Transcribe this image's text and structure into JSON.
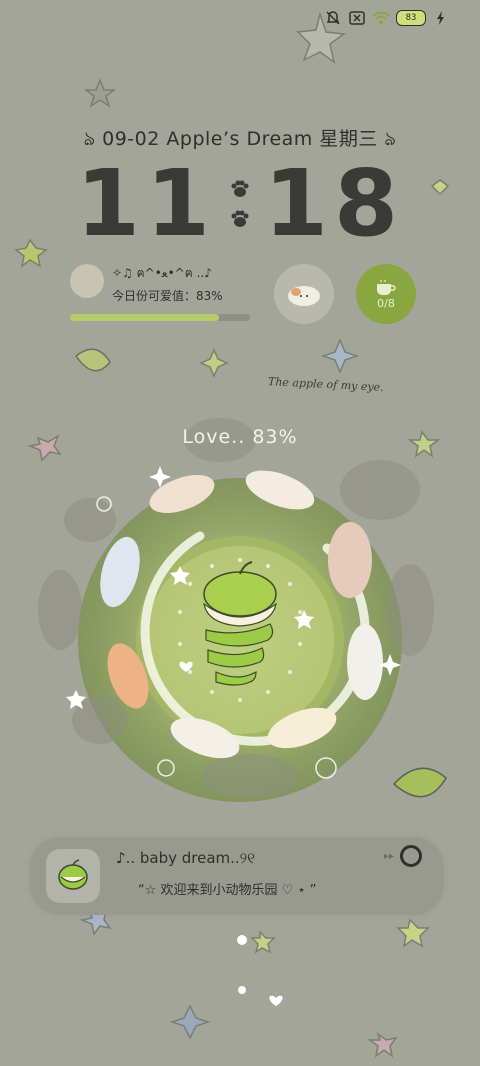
{
  "status_bar": {
    "battery": "83"
  },
  "header": {
    "date_text": "ঌ 09-02 Apple’s Dream 星期三 ঌ"
  },
  "clock": {
    "hours": "11",
    "minutes": "18"
  },
  "mood": {
    "line1": "✧♫ ฅ^•ﻌ•^ฅ ..♪",
    "line2": "今日份可爱值：83%",
    "progress": 0.83
  },
  "drink": {
    "count": "0/8"
  },
  "tagline": "The apple of my eye.",
  "love_label": "Love.. 83%",
  "player": {
    "title": "♪.. baby dream..୨୧",
    "subtitle": "“☆  欢迎来到小动物乐园 ♡ ⋆ ”"
  },
  "colors": {
    "accent": "#8aa640",
    "background": "#a3a59b",
    "text": "#2f302b"
  }
}
